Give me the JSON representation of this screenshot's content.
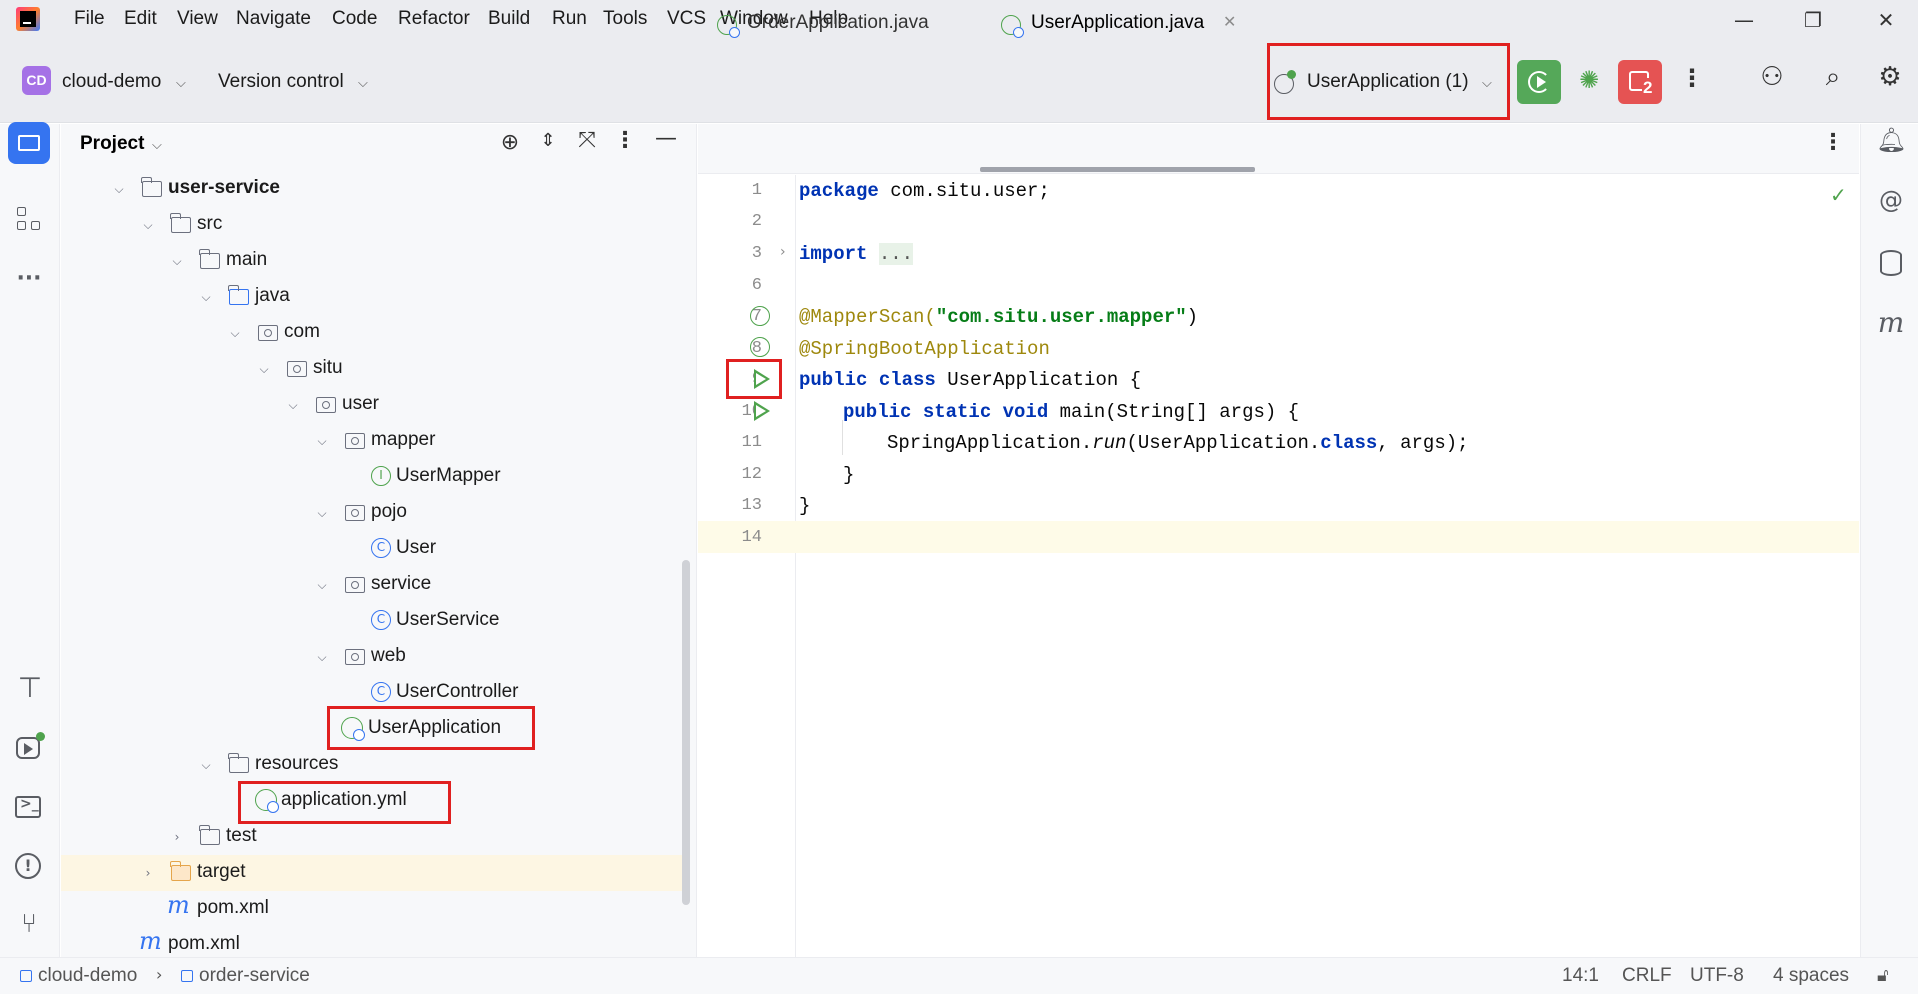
{
  "menu": [
    "File",
    "Edit",
    "View",
    "Navigate",
    "Code",
    "Refactor",
    "Build",
    "Run",
    "Tools",
    "VCS",
    "Window",
    "Help"
  ],
  "window_controls": {
    "minimize": "—",
    "restore": "❐",
    "close": "✕"
  },
  "toolbar": {
    "project_badge": "CD",
    "project_name": "cloud-demo",
    "vcs_label": "Version control",
    "run_config": "UserApplication (1)",
    "running_count": "2"
  },
  "project_panel": {
    "title": "Project",
    "tree": [
      {
        "label": "user-service",
        "bold": true
      },
      {
        "label": "src"
      },
      {
        "label": "main"
      },
      {
        "label": "java"
      },
      {
        "label": "com"
      },
      {
        "label": "situ"
      },
      {
        "label": "user"
      },
      {
        "label": "mapper"
      },
      {
        "label": "UserMapper"
      },
      {
        "label": "pojo"
      },
      {
        "label": "User"
      },
      {
        "label": "service"
      },
      {
        "label": "UserService"
      },
      {
        "label": "web"
      },
      {
        "label": "UserController"
      },
      {
        "label": "UserApplication"
      },
      {
        "label": "resources"
      },
      {
        "label": "application.yml"
      },
      {
        "label": "test"
      },
      {
        "label": "target"
      },
      {
        "label": "pom.xml"
      },
      {
        "label": "pom.xml"
      }
    ]
  },
  "editor": {
    "tabs": [
      {
        "label": "OrderApplication.java",
        "active": false
      },
      {
        "label": "UserApplication.java",
        "active": true
      }
    ],
    "line_numbers": [
      "1",
      "2",
      "3",
      "6",
      "7",
      "8",
      "9",
      "10",
      "11",
      "12",
      "13",
      "14"
    ],
    "code": {
      "l1_kw": "package",
      "l1_rest": " com.situ.user;",
      "l3_kw": "import",
      "l3_fold": "...",
      "l7_ann": "@MapperScan(",
      "l7_str": "\"com.situ.user.mapper\"",
      "l7_end": ")",
      "l8_ann": "@SpringBootApplication",
      "l9_kw": "public class",
      "l9_rest": " UserApplication {",
      "l10_kw": "public static void",
      "l10_rest": " main(String[] args) {",
      "l11_a": "SpringApplication.",
      "l11_run": "run",
      "l11_b": "(UserApplication.",
      "l11_cls": "class",
      "l11_c": ", args);",
      "l12": "}",
      "l13": "}"
    }
  },
  "statusbar": {
    "breadcrumb_1": "cloud-demo",
    "breadcrumb_2": "order-service",
    "position": "14:1",
    "line_sep": "CRLF",
    "encoding": "UTF-8",
    "indent": "4 spaces"
  },
  "colors": {
    "accent": "#3574f0",
    "run_green": "#55a859",
    "stop_red": "#e55353",
    "highlight_box": "#e02020"
  }
}
